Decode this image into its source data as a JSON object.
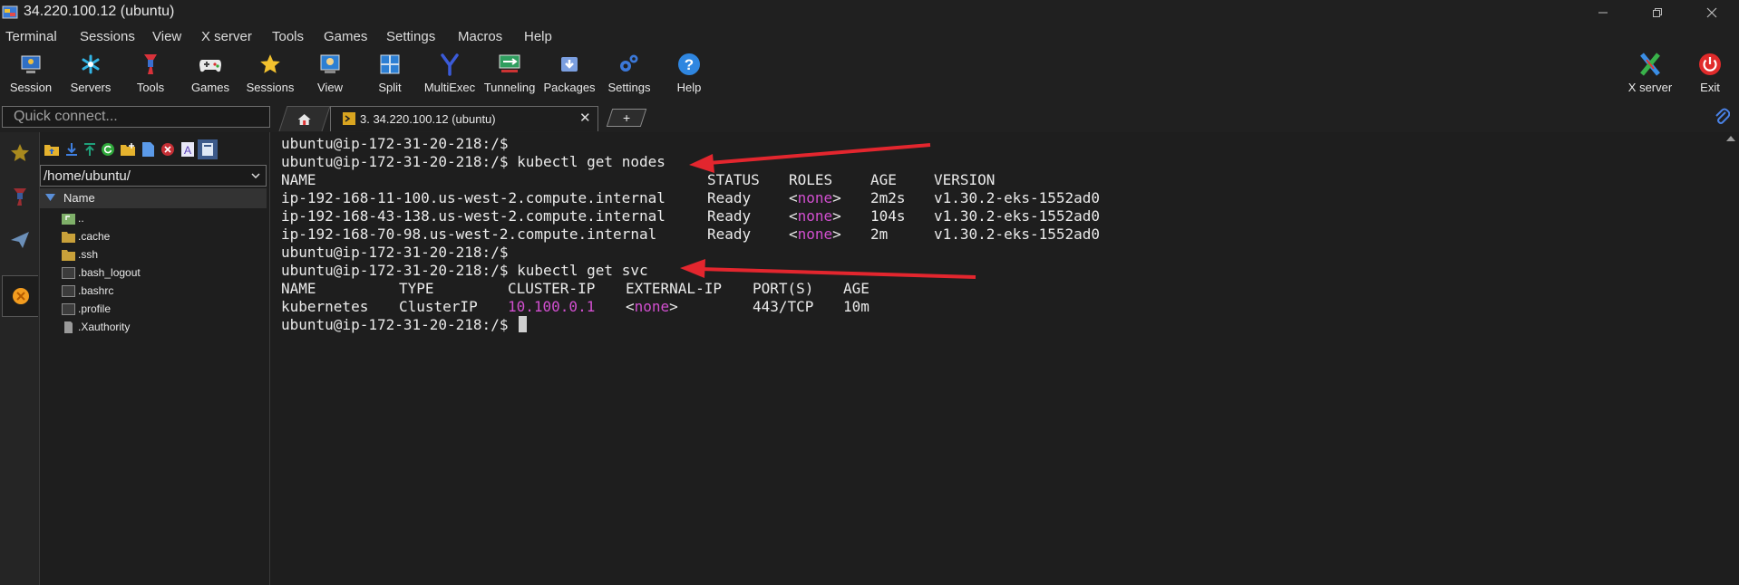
{
  "window": {
    "title": "34.220.100.12 (ubuntu)",
    "controls": {
      "minimize_icon": "minimize-icon",
      "maximize_icon": "restore-icon",
      "close_icon": "close-icon"
    }
  },
  "menu": [
    "Terminal",
    "Sessions",
    "View",
    "X server",
    "Tools",
    "Games",
    "Settings",
    "Macros",
    "Help"
  ],
  "toolbar": {
    "left": [
      {
        "label": "Session",
        "icon": "session-icon"
      },
      {
        "label": "Servers",
        "icon": "servers-icon"
      },
      {
        "label": "Tools",
        "icon": "tools-icon"
      },
      {
        "label": "Games",
        "icon": "games-icon"
      },
      {
        "label": "Sessions",
        "icon": "star-icon"
      },
      {
        "label": "View",
        "icon": "view-icon"
      },
      {
        "label": "Split",
        "icon": "split-icon"
      },
      {
        "label": "MultiExec",
        "icon": "multiexec-icon"
      },
      {
        "label": "Tunneling",
        "icon": "tunneling-icon"
      },
      {
        "label": "Packages",
        "icon": "packages-icon"
      },
      {
        "label": "Settings",
        "icon": "settings-icon"
      },
      {
        "label": "Help",
        "icon": "help-icon"
      }
    ],
    "right": [
      {
        "label": "X server",
        "icon": "x-server-icon"
      },
      {
        "label": "Exit",
        "icon": "power-icon"
      }
    ]
  },
  "quick_connect": {
    "placeholder": "Quick connect..."
  },
  "tabs": {
    "home_icon": "home-icon",
    "session_label": "3. 34.220.100.12 (ubuntu)",
    "close_glyph": "✕",
    "new_tab_glyph": "+"
  },
  "sftp": {
    "path": "/home/ubuntu/",
    "column_name": "Name",
    "files": [
      {
        "name": "..",
        "type": "parent"
      },
      {
        "name": ".cache",
        "type": "folder"
      },
      {
        "name": ".ssh",
        "type": "folder"
      },
      {
        "name": ".bash_logout",
        "type": "file"
      },
      {
        "name": ".bashrc",
        "type": "file"
      },
      {
        "name": ".profile",
        "type": "file"
      },
      {
        "name": ".Xauthority",
        "type": "doc"
      }
    ]
  },
  "terminal": {
    "prompt": "ubuntu@ip-172-31-20-218:/$",
    "cmd1": "kubectl get nodes",
    "cmd2": "kubectl get svc",
    "nodes_header": [
      "NAME",
      "STATUS",
      "ROLES",
      "AGE",
      "VERSION"
    ],
    "nodes": [
      {
        "name": "ip-192-168-11-100.us-west-2.compute.internal",
        "status": "Ready",
        "roles": "none",
        "age": "2m2s",
        "version": "v1.30.2-eks-1552ad0"
      },
      {
        "name": "ip-192-168-43-138.us-west-2.compute.internal",
        "status": "Ready",
        "roles": "none",
        "age": "104s",
        "version": "v1.30.2-eks-1552ad0"
      },
      {
        "name": "ip-192-168-70-98.us-west-2.compute.internal",
        "status": "Ready",
        "roles": "none",
        "age": "2m",
        "version": "v1.30.2-eks-1552ad0"
      }
    ],
    "svc_header": [
      "NAME",
      "TYPE",
      "CLUSTER-IP",
      "EXTERNAL-IP",
      "PORT(S)",
      "AGE"
    ],
    "svc": [
      {
        "name": "kubernetes",
        "type": "ClusterIP",
        "cluster_ip": "10.100.0.1",
        "external_ip": "none",
        "ports": "443/TCP",
        "age": "10m"
      }
    ]
  },
  "colors": {
    "highlight": "#d24fd0",
    "arrow": "#e3262e",
    "background": "#1e1e1e"
  }
}
